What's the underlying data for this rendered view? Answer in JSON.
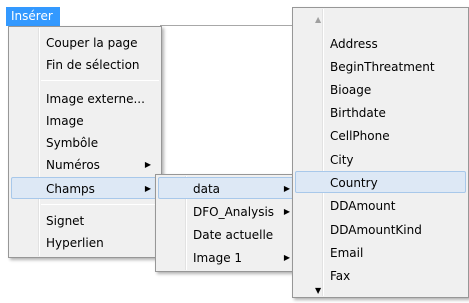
{
  "menubar": {
    "title": "Insérer"
  },
  "menu_main": {
    "items": [
      {
        "label": "Couper la page"
      },
      {
        "label": "Fin de sélection"
      },
      {
        "label": "Image externe..."
      },
      {
        "label": "Image"
      },
      {
        "label": "Symbôle"
      },
      {
        "label": "Numéros"
      },
      {
        "label": "Champs"
      },
      {
        "label": "Signet"
      },
      {
        "label": "Hyperlien"
      }
    ]
  },
  "menu_champs": {
    "items": [
      {
        "label": "data"
      },
      {
        "label": "DFO_Analysis"
      },
      {
        "label": "Date actuelle"
      },
      {
        "label": "Image 1"
      }
    ]
  },
  "menu_data": {
    "items": [
      {
        "label": "Address"
      },
      {
        "label": "BeginThreatment"
      },
      {
        "label": "Bioage"
      },
      {
        "label": "Birthdate"
      },
      {
        "label": "CellPhone"
      },
      {
        "label": "City"
      },
      {
        "label": "Country"
      },
      {
        "label": "DDAmount"
      },
      {
        "label": "DDAmountKind"
      },
      {
        "label": "Email"
      },
      {
        "label": "Fax"
      }
    ]
  },
  "colors": {
    "highlight": "#3399ff",
    "hover": "#dde8f5",
    "menu_bg": "#f0f0f0"
  }
}
